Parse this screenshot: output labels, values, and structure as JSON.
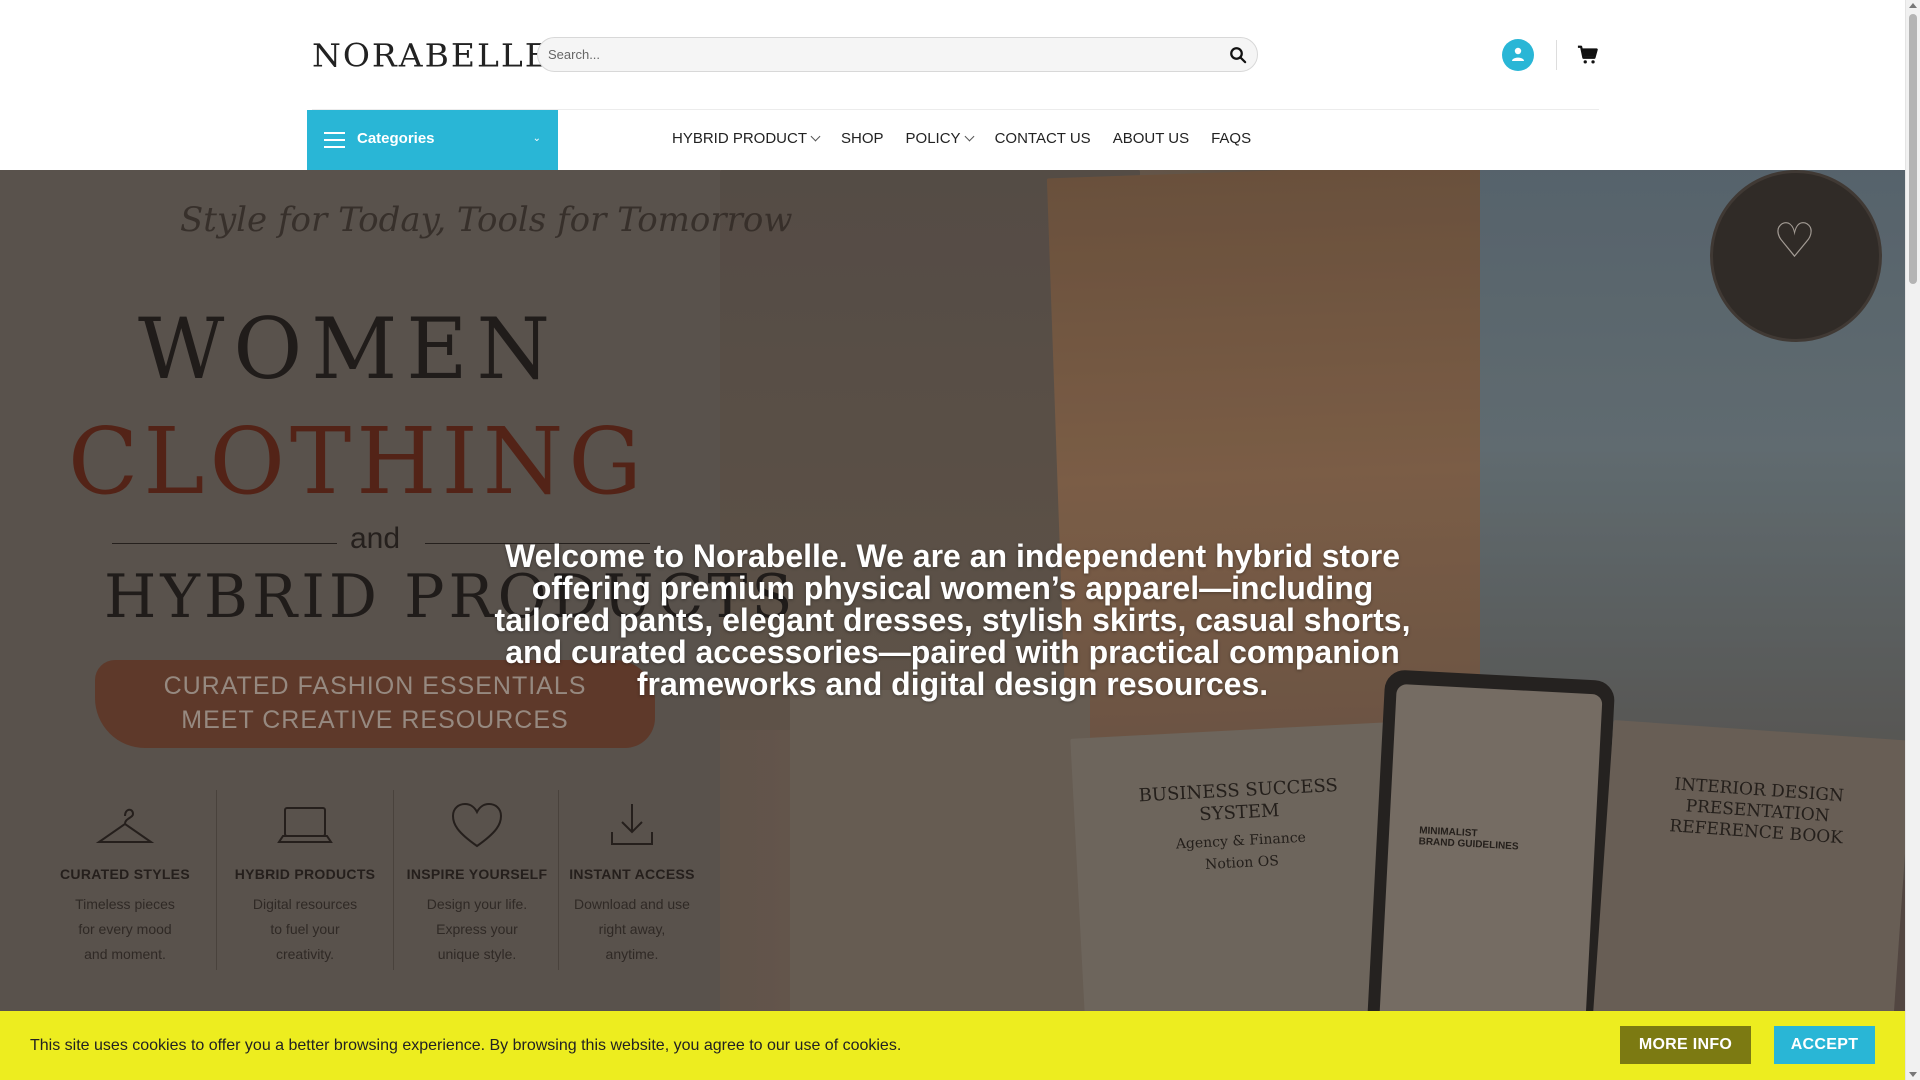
{
  "header": {
    "logo": "NORABELLE",
    "search": {
      "placeholder": "Search..."
    },
    "icons": {
      "search": "search-icon",
      "account": "user-icon",
      "cart": "cart-icon"
    }
  },
  "nav": {
    "categories_label": "Categories",
    "items": [
      {
        "label": "HYBRID PRODUCT",
        "has_dropdown": true
      },
      {
        "label": "SHOP",
        "has_dropdown": false
      },
      {
        "label": "POLICY",
        "has_dropdown": true
      },
      {
        "label": "CONTACT US",
        "has_dropdown": false
      },
      {
        "label": "ABOUT US",
        "has_dropdown": false
      },
      {
        "label": "FAQS",
        "has_dropdown": false
      }
    ]
  },
  "hero": {
    "tagline": "Style for Today, Tools for Tomorrow",
    "line1": "WOMEN",
    "line2": "CLOTHING",
    "and": "and",
    "line3": "HYBRID PRODUCTS",
    "banner1": "CURATED FASHION ESSENTIALS",
    "banner2": "MEET CREATIVE RESOURCES",
    "features": [
      {
        "icon": "hanger-icon",
        "title": "CURATED STYLES",
        "lines": [
          "Timeless pieces",
          "for every mood",
          "and moment."
        ]
      },
      {
        "icon": "laptop-icon",
        "title": "HYBRID PRODUCTS",
        "lines": [
          "Digital resources",
          "to fuel your",
          "creativity."
        ]
      },
      {
        "icon": "heart-icon",
        "title": "INSPIRE YOURSELF",
        "lines": [
          "Design your life.",
          "Express your",
          "unique style."
        ]
      },
      {
        "icon": "download-icon",
        "title": "INSTANT ACCESS",
        "lines": [
          "Download and use",
          "right away,",
          "anytime."
        ]
      }
    ],
    "notebook1": {
      "title1": "BUSINESS SUCCESS",
      "title2": "SYSTEM",
      "sub1": "Agency & Finance",
      "sub2": "Notion OS"
    },
    "tablet": {
      "title1": "MINIMALIST",
      "title2": "BRAND GUIDELINES"
    },
    "book2": {
      "title1": "INTERIOR DESIGN",
      "title2": "PRESENTATION",
      "title3": "REFERENCE BOOK"
    },
    "welcome": "Welcome to Norabelle. We are an independent hybrid store offering premium physical women’s apparel—including tailored pants, elegant dresses, stylish skirts, casual shorts, and curated accessories—paired with practical companion frameworks and digital design resources."
  },
  "cookie": {
    "message": "This site uses cookies to offer you a better browsing experience. By browsing this website, you agree to our use of cookies.",
    "more_info": "MORE INFO",
    "accept": "ACCEPT",
    "bar_color": "#eded1f"
  },
  "colors": {
    "accent": "#29b6d6",
    "more_info_bg": "#7c7a12"
  }
}
